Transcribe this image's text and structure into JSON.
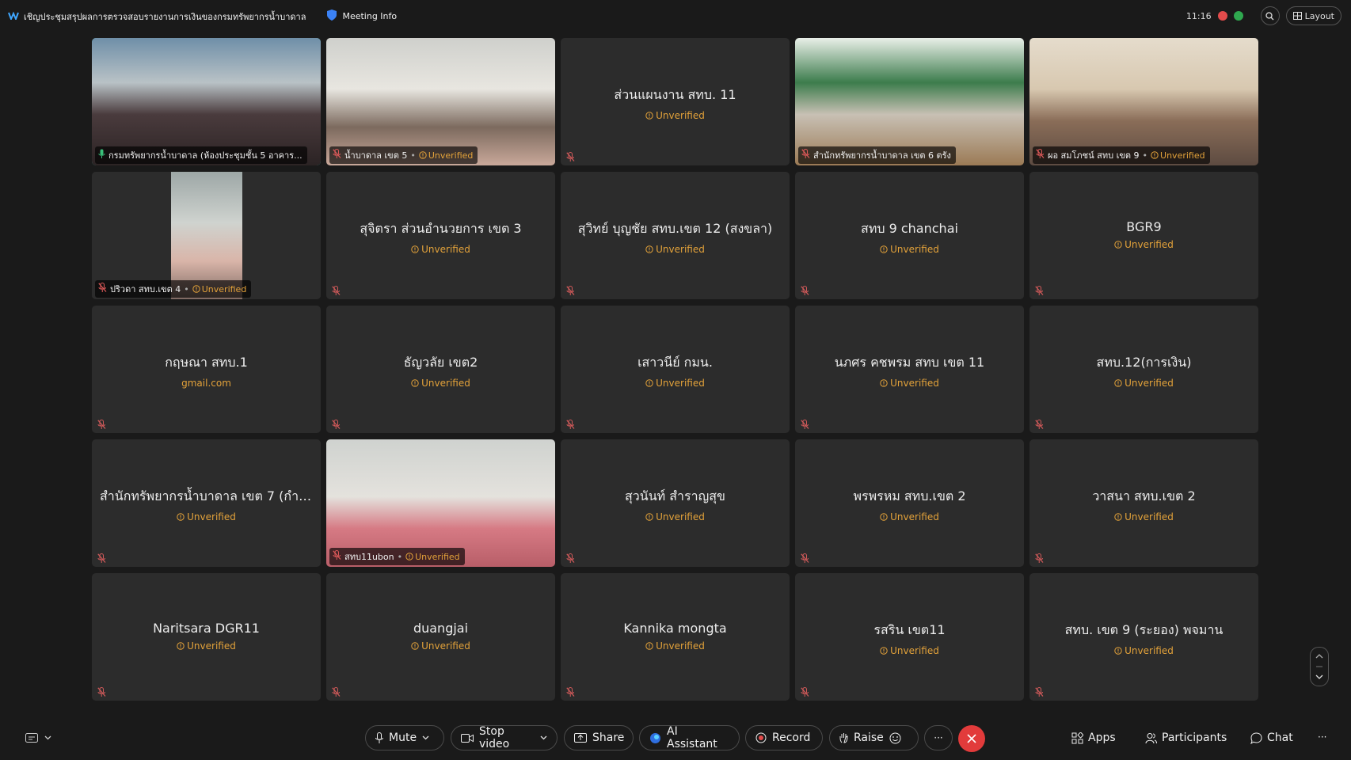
{
  "meeting": {
    "title": "เชิญประชุมสรุปผลการตรวจสอบรายงานการเงินของกรมทรัพยากรน้ำบาดาล",
    "info_label": "Meeting Info",
    "time": "11:16",
    "layout_label": "Layout"
  },
  "status_text": "Unverified",
  "tiles": [
    {
      "name": "กรมทรัพยากรน้ำบาดาล (ห้องประชุมชั้น 5 อาคาร...",
      "sub": "",
      "video": true
    },
    {
      "name": "น้ำบาดาล เขต 5",
      "sub": "Unverified",
      "video": true
    },
    {
      "name": "ส่วนแผนงาน สทบ. 11",
      "sub": "Unverified",
      "video": false
    },
    {
      "name": "สำนักทรัพยากรน้ำบาดาล เขต 6 ตรัง",
      "sub": "",
      "video": true
    },
    {
      "name": "ผอ สมโภชน์ สทบ เขต 9",
      "sub": "Unverified",
      "video": true
    },
    {
      "name": "ปริวดา สทบ.เขต 4",
      "sub": "Unverified",
      "video": true
    },
    {
      "name": "สุจิตรา ส่วนอำนวยการ เขต 3",
      "sub": "Unverified",
      "video": false
    },
    {
      "name": "สุวิทย์ บุญชัย สทบ.เขต 12 (สงขลา)",
      "sub": "Unverified",
      "video": false
    },
    {
      "name": "สทบ 9 chanchai",
      "sub": "Unverified",
      "video": false
    },
    {
      "name": "BGR9",
      "sub": "Unverified",
      "video": false
    },
    {
      "name": "กฤษณา สทบ.1",
      "sub": "gmail.com",
      "video": false
    },
    {
      "name": "ธัญวลัย เขต2",
      "sub": "Unverified",
      "video": false
    },
    {
      "name": "เสาวนีย์ กมน.",
      "sub": "Unverified",
      "video": false
    },
    {
      "name": "นภศร คชพรม สทบ เขต 11",
      "sub": "Unverified",
      "video": false
    },
    {
      "name": "สทบ.12(การเงิน)",
      "sub": "Unverified",
      "video": false
    },
    {
      "name": "สำนักทรัพยากรน้ำบาดาล เขต 7 (กำแ...",
      "sub": "Unverified",
      "video": false
    },
    {
      "name": "สทบ11ubon",
      "sub": "Unverified",
      "video": true
    },
    {
      "name": "สุวนันท์ สำราญสุข",
      "sub": "Unverified",
      "video": false
    },
    {
      "name": "พรพรหม สทบ.เขต 2",
      "sub": "Unverified",
      "video": false
    },
    {
      "name": "วาสนา  สทบ.เขต 2",
      "sub": "Unverified",
      "video": false
    },
    {
      "name": "Naritsara DGR11",
      "sub": "Unverified",
      "video": false
    },
    {
      "name": "duangjai",
      "sub": "Unverified",
      "video": false
    },
    {
      "name": "Kannika mongta",
      "sub": "Unverified",
      "video": false
    },
    {
      "name": "รสริน เขต11",
      "sub": "Unverified",
      "video": false
    },
    {
      "name": "สทบ. เขต 9 (ระยอง) พจมาน",
      "sub": "Unverified",
      "video": false
    }
  ],
  "controls": {
    "mute": "Mute",
    "stop_video": "Stop video",
    "share": "Share",
    "ai_assistant": "AI Assistant",
    "record": "Record",
    "raise": "Raise",
    "more": "···",
    "apps": "Apps",
    "participants": "Participants",
    "chat": "Chat",
    "overflow": "···"
  },
  "colors": {
    "accent": "#2aa398",
    "warning": "#e3a23a",
    "end_call": "#e23b3b",
    "record_dot": "#e24b4b"
  }
}
